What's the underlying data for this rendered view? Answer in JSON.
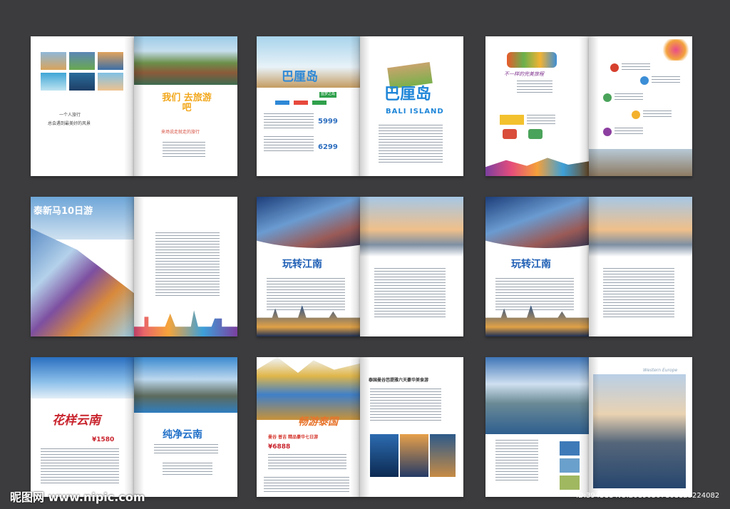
{
  "spread1": {
    "tagline1": "一个人旅行",
    "tagline2": "总会遇到最美好的风景",
    "hero": "我们 去旅游吧",
    "sub": "来场说走就走的旅行"
  },
  "spread2": {
    "title": "巴厘岛",
    "title_right": "巴厘岛",
    "title_en": "BALI ISLAND",
    "price1": "5999",
    "price2": "6299",
    "tag": "蓝梦之岛"
  },
  "spread3": {
    "banner": "不一样的完美旅程"
  },
  "spread4": {
    "title": "泰新马10日游"
  },
  "spread5": {
    "title": "玩转江南"
  },
  "spread6": {
    "title": "玩转江南"
  },
  "spread7": {
    "title": "花样云南",
    "price": "¥1580",
    "title_right": "纯净云南"
  },
  "spread8": {
    "title": "畅游泰国",
    "subtitle": "曼谷 普吉 精品豪华七日游",
    "price": "¥6888",
    "headline": "泰国曼谷芭提雅六天豪华美食游"
  },
  "spread9": {
    "title_right": "Western Europe"
  },
  "watermark": {
    "site": "昵图网 www.nipic.com",
    "id": "ID:394311 NO:20190307161123224082"
  }
}
